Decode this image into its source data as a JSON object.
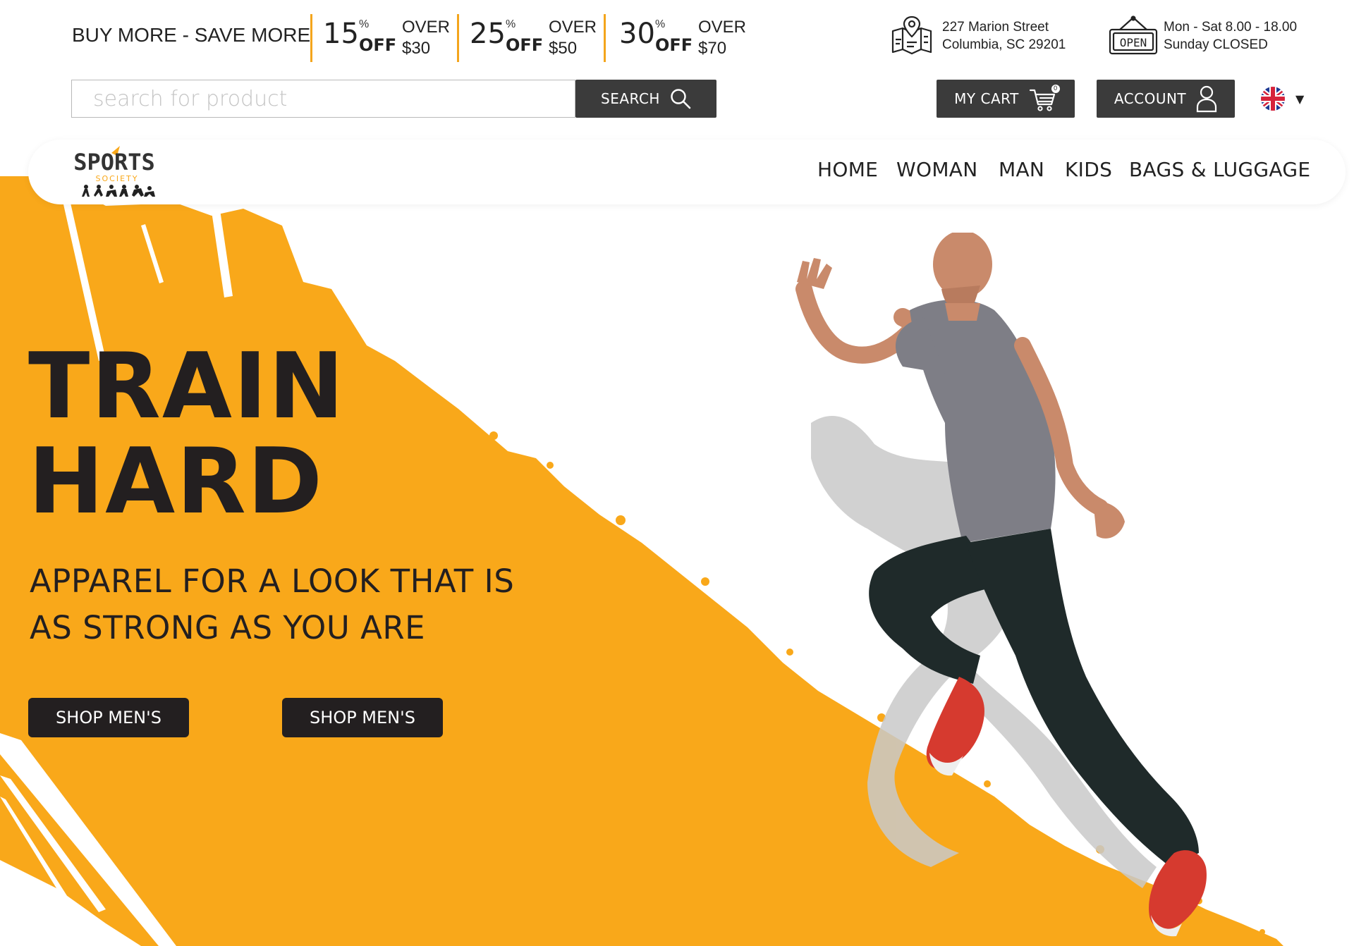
{
  "colors": {
    "accent": "#f9a81a",
    "dark": "#231f20",
    "button": "#3b3b3b",
    "divider": "#f4a51c"
  },
  "promo": {
    "label": "BUY MORE - SAVE MORE",
    "deals": [
      {
        "percent": "15",
        "symbol": "%",
        "off": "OFF",
        "over": "OVER",
        "amount": "$30"
      },
      {
        "percent": "25",
        "symbol": "%",
        "off": "OFF",
        "over": "OVER",
        "amount": "$50"
      },
      {
        "percent": "30",
        "symbol": "%",
        "off": "OFF",
        "over": "OVER",
        "amount": "$70"
      }
    ]
  },
  "store": {
    "address_line1": "227 Marion Street",
    "address_line2": "Columbia, SC 29201",
    "hours_line1": "Mon - Sat 8.00 - 18.00",
    "hours_line2": "Sunday CLOSED",
    "open_sign": "OPEN",
    "location_icon": "map-location-icon",
    "sign_icon": "open-sign-icon"
  },
  "search": {
    "placeholder": "search for product",
    "value": "",
    "button_label": "SEARCH",
    "icon": "search-icon"
  },
  "header": {
    "cart_label": "MY CART",
    "cart_count": "0",
    "cart_icon": "cart-icon",
    "account_label": "ACCOUNT",
    "account_icon": "user-icon",
    "language_icon": "uk-flag-icon"
  },
  "logo": {
    "line1": "SPORTS",
    "line2": "SOCIETY"
  },
  "nav": {
    "items": [
      "HOME",
      "WOMAN",
      "MAN",
      "KIDS",
      "BAGS & LUGGAGE"
    ]
  },
  "hero": {
    "headline_line1": "TRAIN",
    "headline_line2": "HARD",
    "sub_line1": "APPAREL FOR A LOOK THAT IS",
    "sub_line2": "AS STRONG AS YOU ARE",
    "button1": "SHOP MEN'S",
    "button2": "SHOP MEN'S",
    "image": "running-man-photo"
  }
}
